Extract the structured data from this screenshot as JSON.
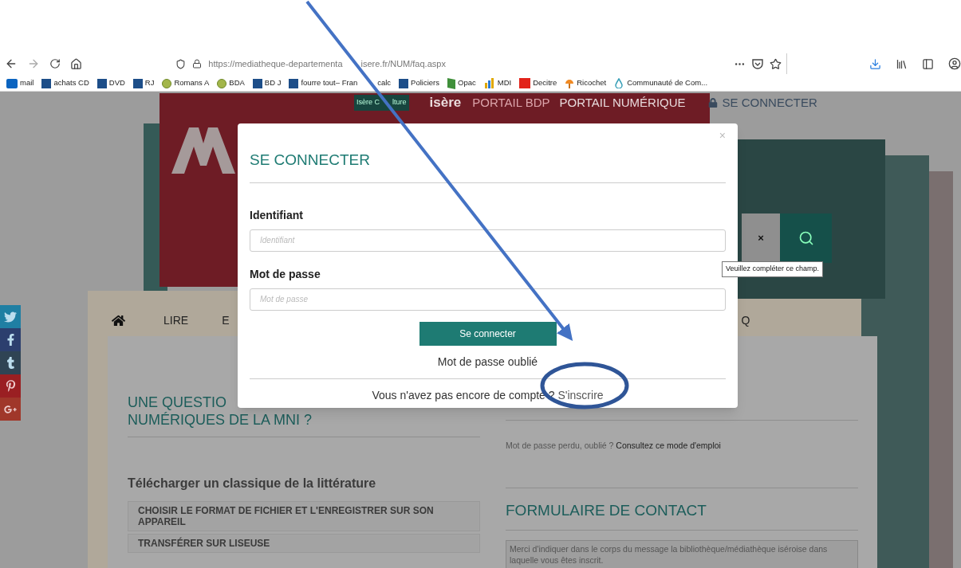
{
  "browser": {
    "url_parts": [
      "https://mediatheque-departementa",
      "isere.fr/NUM/faq.aspx"
    ],
    "bookmarks": [
      {
        "label": "mail",
        "kind": "outlook"
      },
      {
        "label": "achats CD",
        "kind": "e"
      },
      {
        "label": "DVD",
        "kind": "e"
      },
      {
        "label": "RJ",
        "kind": "e"
      },
      {
        "label": "Romans A",
        "kind": "globe"
      },
      {
        "label": "BDA",
        "kind": "globe"
      },
      {
        "label": "BD J",
        "kind": "e"
      },
      {
        "label_parts": [
          "fourre tout– Fran",
          "calc"
        ],
        "kind": "e"
      },
      {
        "label": "Policiers",
        "kind": "e"
      },
      {
        "label": "Opac",
        "kind": "book"
      },
      {
        "label": "MDI",
        "kind": "chart"
      },
      {
        "label": "Decitre",
        "kind": "decitre"
      },
      {
        "label": "Ricochet",
        "kind": "ricochet"
      },
      {
        "label": "Communauté de Com...",
        "kind": "cc"
      }
    ]
  },
  "site_header": {
    "badge_parts": [
      "Isère C",
      "lture"
    ],
    "logo": "isère",
    "portals": [
      {
        "label": "PORTAIL BDP",
        "selected": false
      },
      {
        "label": "PORTAIL NUMÉRIQUE",
        "selected": true
      }
    ],
    "login_link": "SE CONNECTER"
  },
  "search": {
    "clear": "×"
  },
  "tooltip": "Veuillez compléter ce champ.",
  "nav": [
    "LIRE",
    "E",
    "Q"
  ],
  "faq": {
    "heading_lines": [
      "UNE QUESTIO",
      "NUMÉRIQUES DE LA MNI ?"
    ],
    "section": "Télécharger un classique de la littérature",
    "items": [
      "CHOISIR LE FORMAT DE FICHIER ET L'ENREGISTRER SUR SON APPAREIL",
      "TRANSFÉRER SUR LISEUSE"
    ]
  },
  "help": {
    "text": "Mot de passe perdu, oublié ?",
    "link": "Consultez ce mode d'emploi"
  },
  "contact": {
    "title": "FORMULAIRE DE CONTACT",
    "placeholder": "Merci d'indiquer dans le corps du message la bibliothèque/médiathèque iséroise dans laquelle vous êtes inscrit."
  },
  "modal": {
    "title": "SE CONNECTER",
    "close": "×",
    "fields": [
      {
        "label": "Identifiant",
        "placeholder": "Identifiant"
      },
      {
        "label": "Mot de passe",
        "placeholder": "Mot de passe"
      }
    ],
    "submit": "Se connecter",
    "forgot": "Mot de passe oublié",
    "signup_prompt": "Vous n'avez pas encore de compte ?",
    "signup_link": "S'inscrire"
  }
}
